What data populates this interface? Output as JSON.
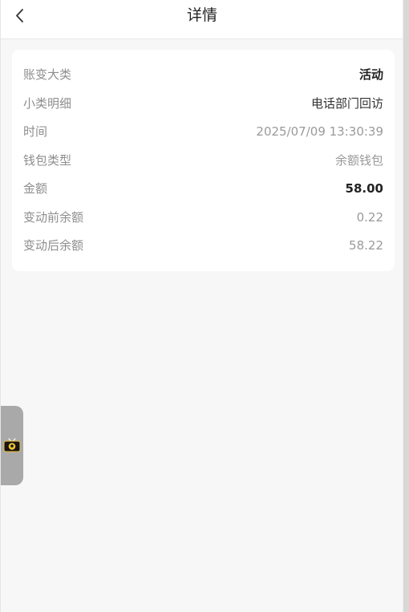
{
  "header": {
    "title": "详情",
    "back_icon": "chevron-left-icon"
  },
  "details": {
    "rows": [
      {
        "label": "账变大类",
        "value": "活动"
      },
      {
        "label": "小类明细",
        "value": "电话部门回访"
      },
      {
        "label": "时间",
        "value": "2025/07/09 13:30:39"
      },
      {
        "label": "钱包类型",
        "value": "余额钱包"
      },
      {
        "label": "金额",
        "value": "58.00"
      },
      {
        "label": "变动前余额",
        "value": "0.22"
      },
      {
        "label": "变动后余额",
        "value": "58.22"
      }
    ]
  },
  "float_widget": {
    "icon": "tv-soccer-icon"
  },
  "colors": {
    "background": "#f7f7f7",
    "card": "#ffffff",
    "label": "#8e8e8e",
    "value": "#9a9a9a",
    "emphasis": "#222222"
  }
}
